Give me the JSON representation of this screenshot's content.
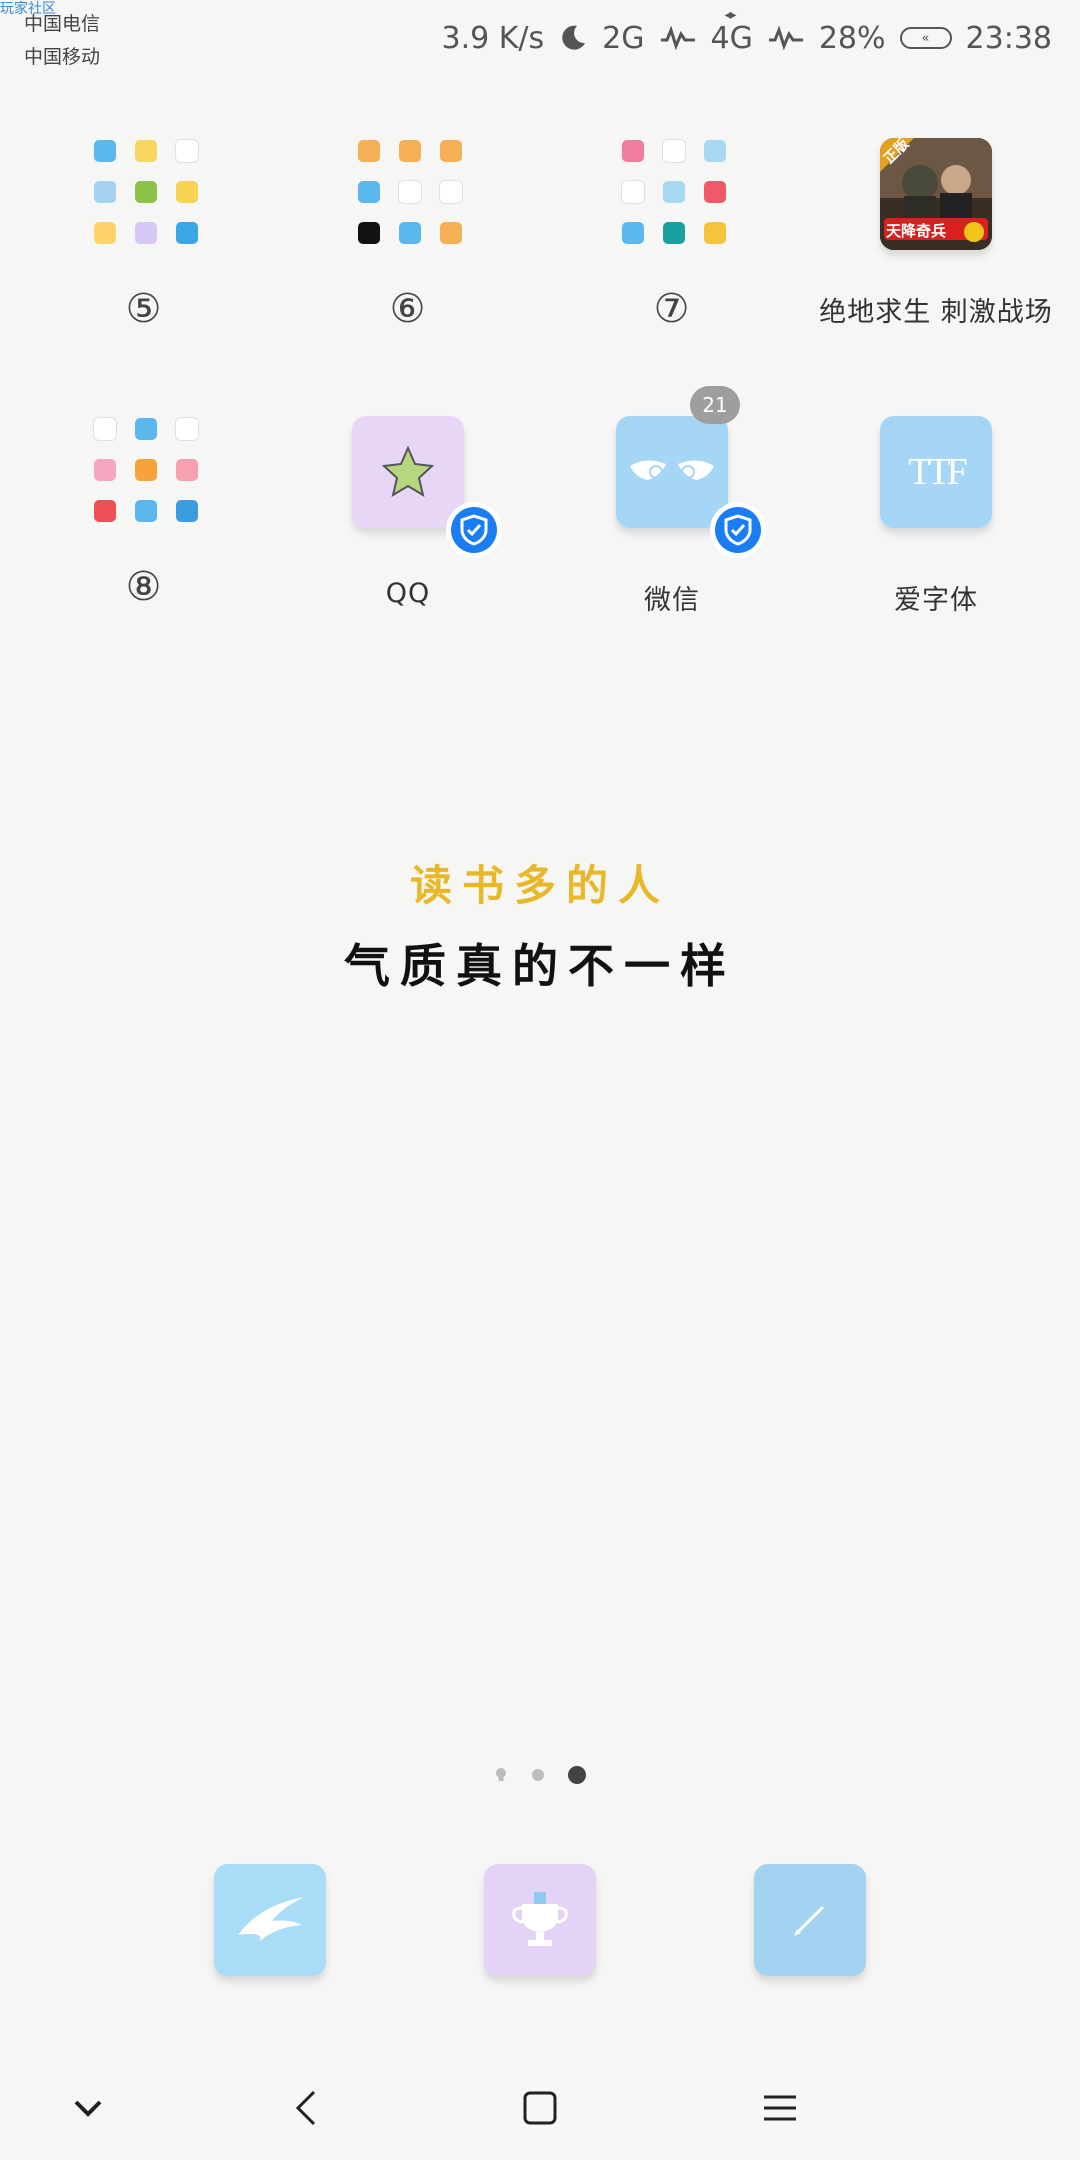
{
  "statusbar": {
    "watermark": "玩家社区",
    "carrier1": "中国电信",
    "carrier2": "中国移动",
    "speed": "3.9 K/s",
    "net1": "2G",
    "net2": "4G",
    "battery": "28%",
    "time": "23:38",
    "icons": [
      "moon-icon",
      "signal-wave-icon",
      "signal-wave-icon",
      "battery-icon"
    ]
  },
  "folders": [
    {
      "label": "⑤",
      "colors": [
        "#5bb8ec",
        "#f8d55e",
        "#ffffff",
        "#a7d1f3",
        "#8bc34a",
        "#f6d451",
        "#ffd36a",
        "#d7c7f5",
        "#3ba6e6"
      ]
    },
    {
      "label": "⑥",
      "colors": [
        "#f5b055",
        "#f5b055",
        "#f5b055",
        "#5bb8ec",
        "#ffffff",
        "#ffffff",
        "#111111",
        "#5bb8ec",
        "#f5b055"
      ]
    },
    {
      "label": "⑦",
      "colors": [
        "#f07ca0",
        "#ffffff",
        "#a7d8f3",
        "#ffffff",
        "#a7d8f3",
        "#ee5a6a",
        "#5bb8ec",
        "#1aa0a0",
        "#f5c43a"
      ]
    },
    {
      "label": "⑧",
      "colors": [
        "#ffffff",
        "#5bb8ec",
        "#ffffff",
        "#f6a6c0",
        "#f5a33a",
        "#f6a0b0",
        "#ef5057",
        "#5bb8ec",
        "#3b9de0"
      ]
    }
  ],
  "apps": {
    "pubg": {
      "label": "绝地求生 刺激战场",
      "badge_text": "正版",
      "banner": "天降奇兵"
    },
    "qq": {
      "label": "QQ",
      "bg": "#e7d6f6"
    },
    "wechat": {
      "label": "微信",
      "badge": "21",
      "bg": "#a6d6f5"
    },
    "aizi": {
      "label": "爱字体",
      "bg": "#a6d6f5",
      "glyph": "TTF"
    }
  },
  "quote": {
    "line1": "读书多的人",
    "line2": "气质真的不一样",
    "accent": "#e9b828"
  },
  "pages": {
    "count": 3,
    "current": 3
  },
  "dock": [
    {
      "name": "bird-app-icon",
      "bg": "#a9dcf7"
    },
    {
      "name": "trophy-app-icon",
      "bg": "#e3d3f6"
    },
    {
      "name": "pen-app-icon",
      "bg": "#a3d3f0"
    }
  ],
  "navbar": [
    "chevron-down-icon",
    "back-icon",
    "home-icon",
    "menu-icon"
  ]
}
